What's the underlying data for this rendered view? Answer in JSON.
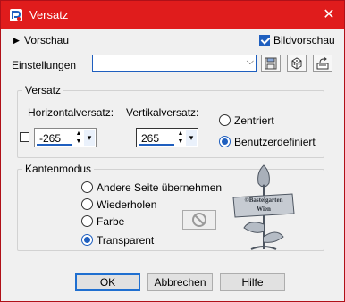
{
  "window": {
    "title": "Versatz",
    "close_glyph": "✕",
    "icon": "app-icon"
  },
  "preview": {
    "label": "Vorschau"
  },
  "bildvorschau": {
    "label": "Bildvorschau",
    "checked": true
  },
  "settings": {
    "label": "Einstellungen",
    "value": ""
  },
  "versatz": {
    "title": "Versatz",
    "horizontal_label": "Horizontalversatz:",
    "vertical_label": "Vertikalversatz:",
    "horizontal_value": "-265",
    "vertical_value": "265",
    "option_centered": "Zentriert",
    "option_custom": "Benutzerdefiniert",
    "selected": "Benutzerdefiniert"
  },
  "kantenmodus": {
    "title": "Kantenmodus",
    "options": [
      "Andere Seite übernehmen",
      "Wiederholen",
      "Farbe",
      "Transparent"
    ],
    "selected": "Transparent"
  },
  "watermark": {
    "line1": "©Bastelgarten",
    "line2": "Wien"
  },
  "buttons": {
    "ok": "OK",
    "cancel": "Abbrechen",
    "help": "Hilfe"
  }
}
